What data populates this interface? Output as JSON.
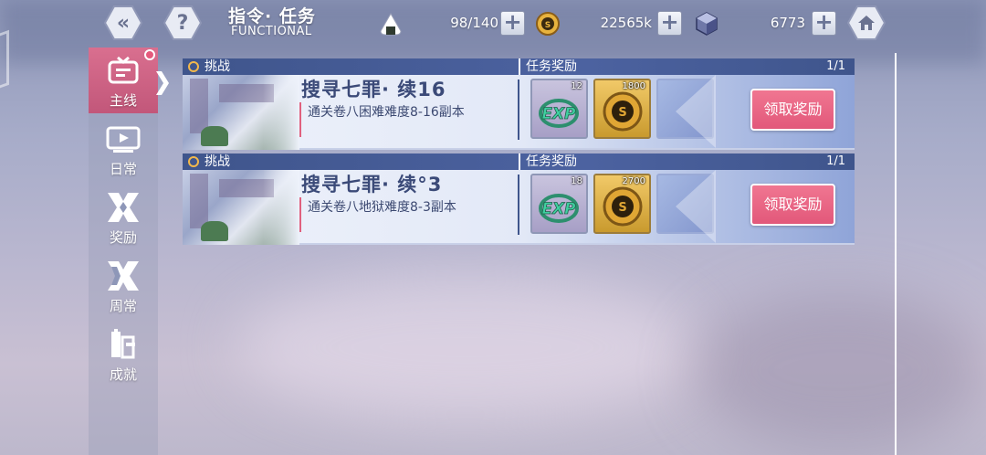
{
  "header": {
    "title": "指令· 任务",
    "subtitle": "FUNCTIONAL",
    "back_icon": "chevron-left-icon",
    "help_icon": "question-mark-icon",
    "home_icon": "home-icon"
  },
  "resources": [
    {
      "name": "stamina",
      "icon": "rice-ball-icon",
      "value": "98/140"
    },
    {
      "name": "gold",
      "icon": "coin-icon",
      "value": "22565k"
    },
    {
      "name": "crystal",
      "icon": "crystal-icon",
      "value": "6773"
    }
  ],
  "sidebar": {
    "items": [
      {
        "label": "主线",
        "icon": "mainline-icon",
        "active": true,
        "badge": true
      },
      {
        "label": "日常",
        "icon": "daily-icon"
      },
      {
        "label": "奖励",
        "icon": "reward-icon"
      },
      {
        "label": "周常",
        "icon": "weekly-icon"
      },
      {
        "label": "成就",
        "icon": "achievement-icon"
      }
    ]
  },
  "tasks": [
    {
      "tag": "挑战",
      "reward_header": "任务奖励",
      "count": "1/1",
      "name": "搜寻七罪· 续16",
      "desc": "通关卷八困难难度8-16副本",
      "rewards": [
        {
          "type": "exp",
          "qty": "12"
        },
        {
          "type": "coin",
          "qty": "1800"
        }
      ],
      "button": "领取奖励"
    },
    {
      "tag": "挑战",
      "reward_header": "任务奖励",
      "count": "1/1",
      "name": "搜寻七罪· 续°3",
      "desc": "通关卷八地狱难度8-3副本",
      "rewards": [
        {
          "type": "exp",
          "qty": "18"
        },
        {
          "type": "coin",
          "qty": "2700"
        }
      ],
      "button": "领取奖励"
    }
  ],
  "colors": {
    "accent": "#e2587a",
    "header_bar": "#3f558c",
    "text_dark": "#3b4a78"
  }
}
